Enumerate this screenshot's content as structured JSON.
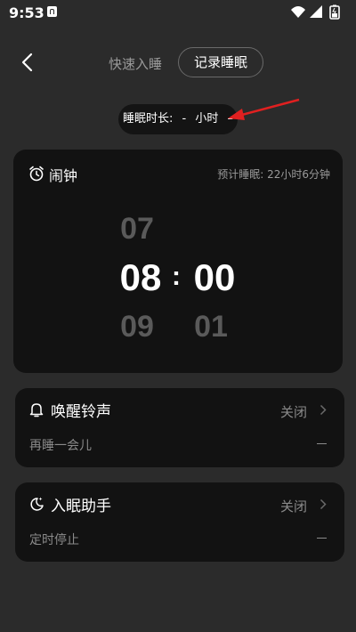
{
  "status": {
    "time": "9:53",
    "icons": [
      "app-notification-icon",
      "wifi-icon",
      "signal-icon",
      "battery-icon"
    ]
  },
  "header": {
    "tab_quick": "快速入睡",
    "tab_record": "记录睡眠"
  },
  "duration": {
    "label": "睡眠时长:",
    "hours_value": "-",
    "hours_unit": "小时",
    "minutes_value": "–"
  },
  "alarm": {
    "title": "闹钟",
    "estimate": "预计睡眠: 22小时6分钟",
    "hour_prev": "07",
    "hour_selected": "08",
    "hour_next": "09",
    "separator": ":",
    "minute_selected": "00",
    "minute_next": "01"
  },
  "wake_sound": {
    "title": "唤醒铃声",
    "state": "关闭",
    "sub_label": "再睡一会儿",
    "sub_value": "–"
  },
  "sleep_helper": {
    "title": "入眠助手",
    "state": "关闭",
    "sub_label": "定时停止",
    "sub_value": "–"
  },
  "colors": {
    "background": "#2b2b2b",
    "card": "#121212",
    "annotation_arrow": "#e02020"
  }
}
